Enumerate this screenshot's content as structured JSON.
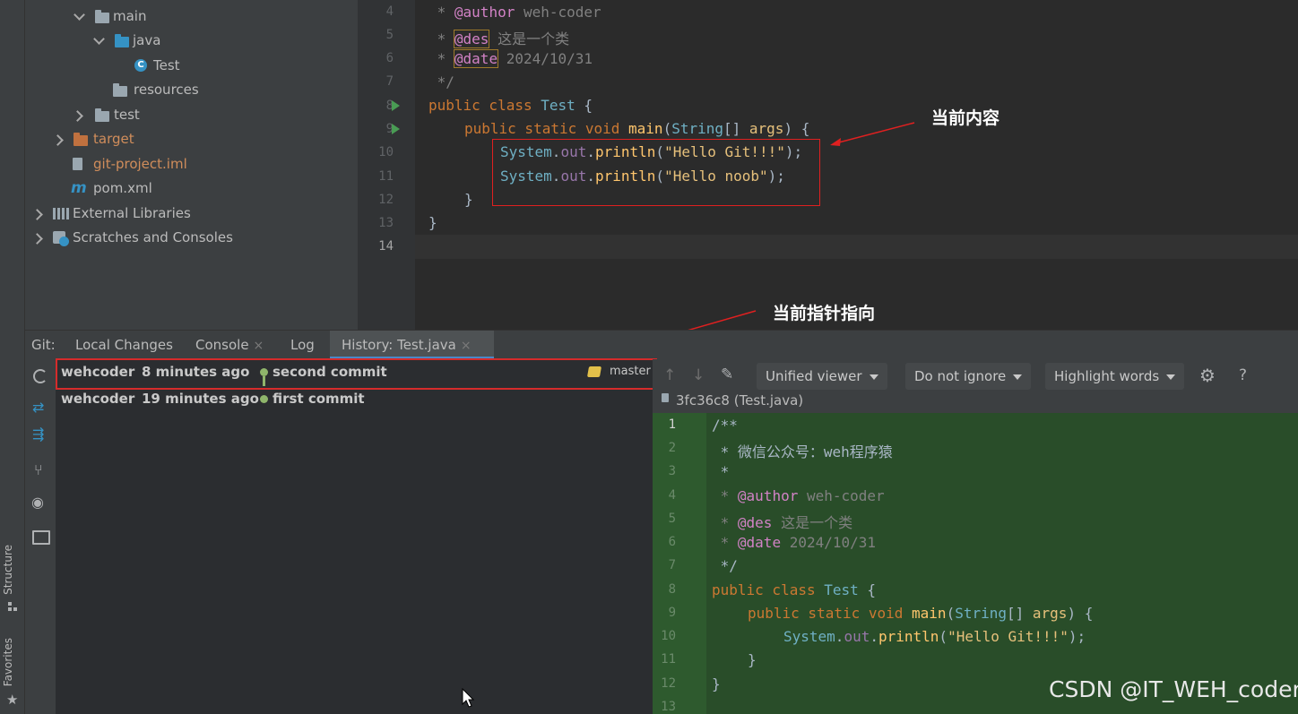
{
  "sidebar_tabs": {
    "structure": "Structure",
    "favorites": "Favorites"
  },
  "tree": {
    "items": [
      {
        "label": "main"
      },
      {
        "label": "java"
      },
      {
        "label": "Test"
      },
      {
        "label": "resources"
      },
      {
        "label": "test"
      },
      {
        "label": "target"
      },
      {
        "label": "git-project.iml"
      },
      {
        "label": "pom.xml"
      },
      {
        "label": "External Libraries"
      },
      {
        "label": "Scratches and Consoles"
      }
    ]
  },
  "editor": {
    "line_numbers": [
      "4",
      "5",
      "6",
      "7",
      "8",
      "9",
      "10",
      "11",
      "12",
      "13",
      "14"
    ],
    "l4_star": " * ",
    "l4_tag": "@author",
    "l4_text": " weh-coder",
    "l5_star": " * ",
    "l5_tag": "@des",
    "l5_text": " 这是一个类",
    "l6_star": " * ",
    "l6_tag": "@date",
    "l6_text": " 2024/10/31",
    "l7": " */",
    "l8_kw": "public class ",
    "l8_cls": "Test",
    "l8_rest": " {",
    "l9_kw": "public static void ",
    "l9_fn": "main",
    "l9_p1": "(",
    "l9_type": "String",
    "l9_p2": "[] ",
    "l9_arg": "args",
    "l9_p3": ") {",
    "l10_cls": "System",
    "l10_dot1": ".",
    "l10_fld": "out",
    "l10_dot2": ".",
    "l10_fn": "println",
    "l10_p1": "(",
    "l10_str": "\"Hello Git!!!\"",
    "l10_p2": ");",
    "l11_cls": "System",
    "l11_dot1": ".",
    "l11_fld": "out",
    "l11_dot2": ".",
    "l11_fn": "println",
    "l11_p1": "(",
    "l11_str": "\"Hello noob\"",
    "l11_p2": ");",
    "l12": "}",
    "l13": "}"
  },
  "annotations": {
    "current_content": "当前内容",
    "current_pointer": "当前指针指向"
  },
  "git_tabs": {
    "prefix": "Git:",
    "local_changes": "Local Changes",
    "console": "Console",
    "log": "Log",
    "history": "History: Test.java",
    "close": "×"
  },
  "history": {
    "rows": [
      {
        "author": "wehcoder",
        "time": "8 minutes ago",
        "message": "second commit",
        "branch": "master"
      },
      {
        "author": "wehcoder",
        "time": "19 minutes ago",
        "message": "first commit"
      }
    ]
  },
  "diff": {
    "unified_viewer": "Unified viewer",
    "ignore": "Do not ignore",
    "highlight": "Highlight words",
    "help": "?",
    "file_label": "3fc36c8 (Test.java)",
    "line_numbers": [
      "1",
      "2",
      "3",
      "4",
      "5",
      "6",
      "7",
      "8",
      "9",
      "10",
      "11",
      "12",
      "13"
    ],
    "d1": "/**",
    "d2": " * 微信公众号：weh程序猿",
    "d3": " *",
    "d4_star": " * ",
    "d4_tag": "@author",
    "d4_text": " weh-coder",
    "d5_star": " * ",
    "d5_tag": "@des",
    "d5_text": " 这是一个类",
    "d6_star": " * ",
    "d6_tag": "@date",
    "d6_text": " 2024/10/31",
    "d7": " */",
    "d8_kw": "public class ",
    "d8_cls": "Test",
    "d8_rest": " {",
    "d9_kw": "public static void ",
    "d9_fn": "main",
    "d9_p1": "(",
    "d9_type": "String",
    "d9_p2": "[] ",
    "d9_arg": "args",
    "d9_p3": ") {",
    "d10_cls": "System",
    "d10_dot1": ".",
    "d10_fld": "out",
    "d10_dot2": ".",
    "d10_fn": "println",
    "d10_p1": "(",
    "d10_str": "\"Hello Git!!!\"",
    "d10_p2": ");",
    "d11": "}",
    "d12": "}"
  },
  "watermark": "CSDN @IT_WEH_coder"
}
